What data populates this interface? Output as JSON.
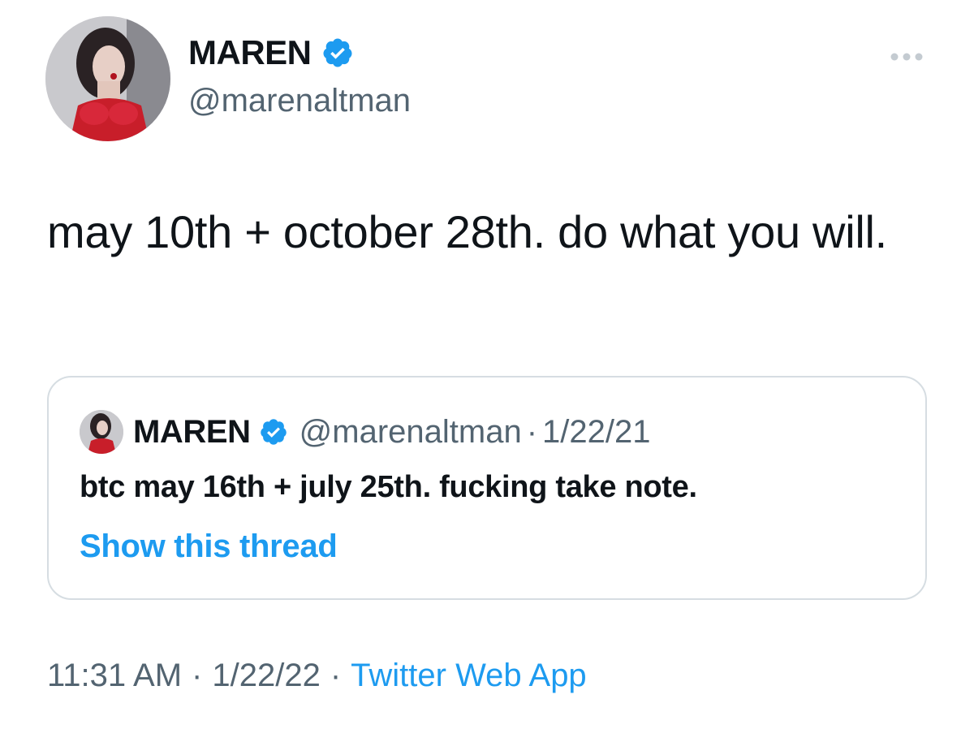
{
  "author": {
    "display_name": "MAREN",
    "handle": "@marenaltman",
    "verified": true
  },
  "tweet": {
    "text": "may 10th + october 28th. do what you will."
  },
  "quoted_tweet": {
    "display_name": "MAREN",
    "handle": "@marenaltman",
    "separator": "·",
    "date": "1/22/21",
    "text": "btc may 16th + july 25th. fucking take note.",
    "show_thread_label": "Show this thread"
  },
  "meta": {
    "time": "11:31 AM",
    "separator": "·",
    "date": "1/22/22",
    "source": "Twitter Web App"
  },
  "icons": {
    "verified_badge": "verified-badge-icon",
    "more": "more-dots-icon"
  },
  "colors": {
    "verified_blue": "#1d9bf0",
    "link_blue": "#1d9bf0",
    "secondary_text": "#536471",
    "border": "#d6dde2"
  }
}
